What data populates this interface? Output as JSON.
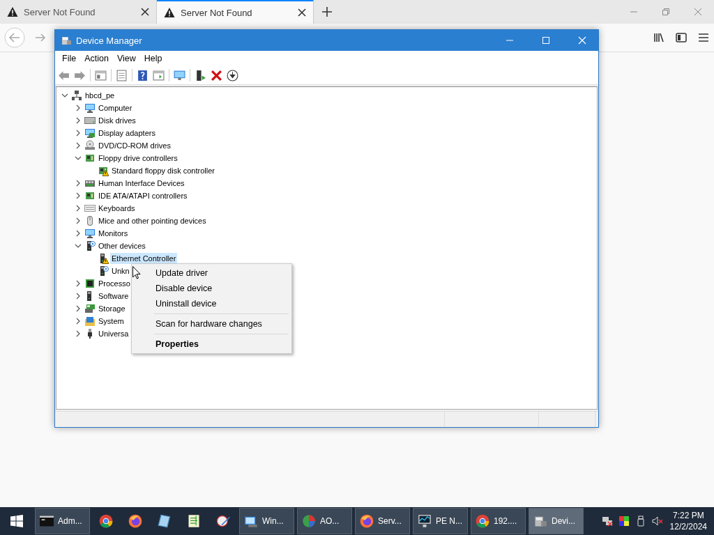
{
  "browser": {
    "tabs": [
      {
        "title": "Server Not Found",
        "selected": false
      },
      {
        "title": "Server Not Found",
        "selected": true
      }
    ]
  },
  "window": {
    "title": "Device Manager",
    "menu": [
      "File",
      "Action",
      "View",
      "Help"
    ],
    "tree": {
      "label": "hbcd_pe",
      "kind": "root",
      "expanded": true,
      "selected": false,
      "children": [
        {
          "label": "Computer",
          "kind": "monitor",
          "expanded": false,
          "selected": false
        },
        {
          "label": "Disk drives",
          "kind": "drive",
          "expanded": false,
          "selected": false
        },
        {
          "label": "Display adapters",
          "kind": "display",
          "expanded": false,
          "selected": false
        },
        {
          "label": "DVD/CD-ROM drives",
          "kind": "dvd",
          "expanded": false,
          "selected": false
        },
        {
          "label": "Floppy drive controllers",
          "kind": "board",
          "expanded": true,
          "selected": false,
          "children": [
            {
              "label": "Standard floppy disk controller",
              "kind": "board-warning",
              "selected": false
            }
          ]
        },
        {
          "label": "Human Interface Devices",
          "kind": "hid",
          "expanded": false,
          "selected": false
        },
        {
          "label": "IDE ATA/ATAPI controllers",
          "kind": "board",
          "expanded": false,
          "selected": false
        },
        {
          "label": "Keyboards",
          "kind": "keyboard",
          "expanded": false,
          "selected": false
        },
        {
          "label": "Mice and other pointing devices",
          "kind": "mouse",
          "expanded": false,
          "selected": false
        },
        {
          "label": "Monitors",
          "kind": "monitor",
          "expanded": false,
          "selected": false
        },
        {
          "label": "Other devices",
          "kind": "tower-unknown",
          "expanded": true,
          "selected": false,
          "children": [
            {
              "label": "Ethernet Controller",
              "kind": "tower-warning",
              "selected": true
            },
            {
              "label": "Unkn",
              "kind": "tower-unknown",
              "selected": false
            }
          ]
        },
        {
          "label": "Processo",
          "kind": "chip",
          "expanded": false,
          "selected": false
        },
        {
          "label": "Software",
          "kind": "tower",
          "expanded": false,
          "selected": false
        },
        {
          "label": "Storage",
          "kind": "storage",
          "expanded": false,
          "selected": false
        },
        {
          "label": "System",
          "kind": "folder",
          "expanded": false,
          "selected": false
        },
        {
          "label": "Universa",
          "kind": "usb",
          "expanded": false,
          "selected": false
        }
      ]
    }
  },
  "context_menu": {
    "items": [
      {
        "kind": "item",
        "label": "Update driver"
      },
      {
        "kind": "item",
        "label": "Disable device"
      },
      {
        "kind": "item",
        "label": "Uninstall device"
      },
      {
        "kind": "separator"
      },
      {
        "kind": "item",
        "label": "Scan for hardware changes"
      },
      {
        "kind": "separator"
      },
      {
        "kind": "default",
        "label": "Properties"
      }
    ]
  },
  "taskbar": {
    "items": [
      {
        "kind": "terminal",
        "label": "Adm...",
        "selected": false
      },
      {
        "kind": "chrome"
      },
      {
        "kind": "firefox"
      },
      {
        "kind": "notepad"
      },
      {
        "kind": "editor"
      },
      {
        "kind": "paint"
      },
      {
        "kind": "explorer",
        "label": "Win...",
        "selected": false
      },
      {
        "kind": "disktool",
        "label": "AO...",
        "selected": false
      },
      {
        "kind": "firefox",
        "label": "Serv...",
        "selected": false
      },
      {
        "kind": "netmon",
        "label": "PE N...",
        "selected": false
      },
      {
        "kind": "chrome",
        "label": "192....",
        "selected": false
      },
      {
        "kind": "device",
        "label": "Devi...",
        "selected": true
      }
    ],
    "clock": {
      "time": "7:22 PM",
      "date": "12/2/2024"
    }
  }
}
